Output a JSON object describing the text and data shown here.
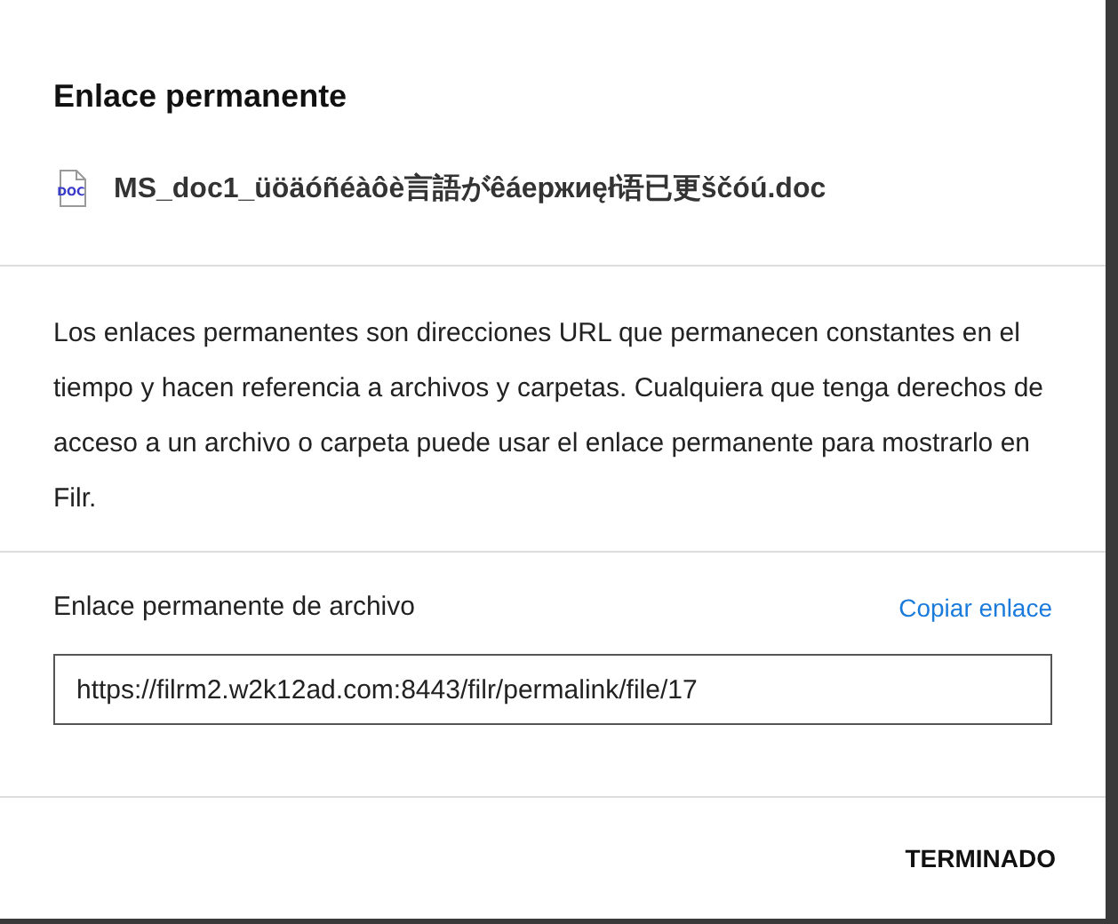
{
  "dialog": {
    "title": "Enlace permanente",
    "file": {
      "icon_label": "DOC",
      "name": "MS_doc1_üöäóñéàôè言語がêáержиęł语已更ščóú.doc"
    },
    "description": "Los enlaces permanentes son direcciones URL que permanecen constantes en el tiempo y hacen referencia a archivos y carpetas. Cualquiera que tenga derechos de acceso a un archivo o carpeta puede usar el enlace permanente para mostrarlo en Filr.",
    "link_label": "Enlace permanente de archivo",
    "copy_link": "Copiar enlace",
    "link_value": "https://filrm2.w2k12ad.com:8443/filr/permalink/file/17",
    "done_button": "TERMINADO"
  }
}
